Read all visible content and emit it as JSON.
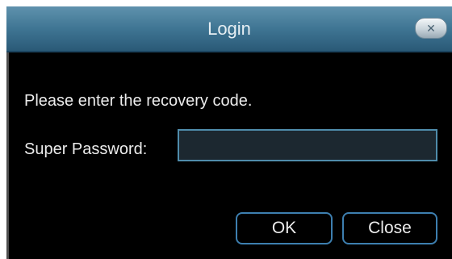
{
  "dialog": {
    "title": "Login",
    "close_icon": "close-x-icon",
    "close_glyph": "✕",
    "prompt": "Please enter the recovery code.",
    "field": {
      "label": "Super Password:",
      "value": "",
      "placeholder": ""
    },
    "buttons": {
      "ok_label": "OK",
      "close_label": "Close"
    }
  },
  "colors": {
    "titlebar": "#3f7593",
    "background": "#000000",
    "accent_border": "#3d7fb0",
    "text": "#ececec"
  }
}
